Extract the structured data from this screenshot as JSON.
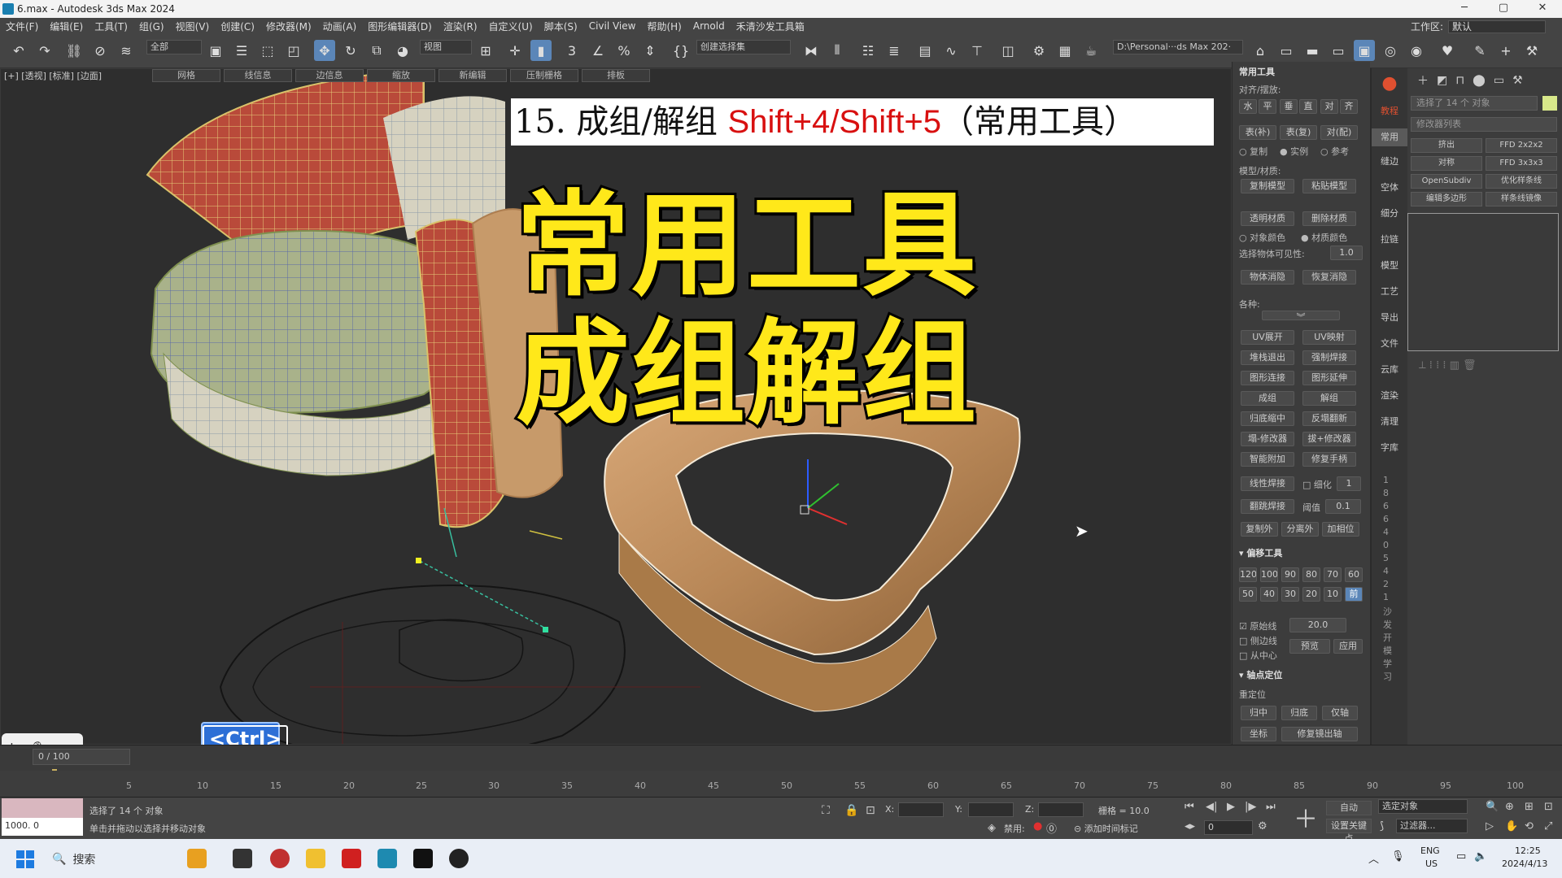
{
  "window": {
    "title": "6.max - Autodesk 3ds Max 2024",
    "min": "─",
    "max": "▢",
    "close": "✕"
  },
  "menu": {
    "items": [
      "文件(F)",
      "编辑(E)",
      "工具(T)",
      "组(G)",
      "视图(V)",
      "创建(C)",
      "修改器(M)",
      "动画(A)",
      "图形编辑器(D)",
      "渲染(R)",
      "自定义(U)",
      "脚本(S)",
      "Civil View",
      "帮助(H)",
      "Arnold",
      "禾清沙发工具箱"
    ],
    "workspace_label": "工作区:",
    "workspace_value": "默认"
  },
  "toolbar": {
    "filter_dropdown": "全部",
    "view_dropdown": "视图",
    "selection_set": "创建选择集",
    "path": "D:\\Personal···ds Max 202·"
  },
  "viewport": {
    "label": "[+] [透视] [标准] [边面]",
    "ribbon": [
      "网格",
      "线信息",
      "边信息",
      "缩放",
      "新编辑",
      "压制栅格",
      "排板"
    ],
    "overlay_number": "15.",
    "overlay_title": "成组/解组",
    "overlay_shortcut": "Shift+4/Shift+5",
    "overlay_suffix": "（常用工具）",
    "big_line1": "常用工具",
    "big_line2": "成组解组",
    "ctrl_badge": "<Ctrl>"
  },
  "tool_panel": {
    "header": "常用工具",
    "align_label": "对齐/摆放:",
    "align_buttons": [
      "水",
      "平",
      "垂",
      "直",
      "对",
      "齐"
    ],
    "table_buttons": [
      "表(补)",
      "表(复)",
      "对(配)"
    ],
    "radio_copy": "复制",
    "radio_instance": "实例",
    "radio_reference": "参考",
    "model_material_label": "模型/材质:",
    "copy_model": "复制模型",
    "paste_model": "粘贴模型",
    "transparent_material": "透明材质",
    "delete_material": "删除材质",
    "object_color": "对象颜色",
    "material_color": "材质颜色",
    "visibility_label": "选择物体可见性:",
    "visibility_value": "1.0",
    "object_hide": "物体消隐",
    "unhide": "恢复消隐",
    "misc_label": "各种:",
    "buttons_grid": [
      [
        "UV展开",
        "UV映射"
      ],
      [
        "堆栈退出",
        "强制焊接"
      ],
      [
        "图形连接",
        "图形延伸"
      ],
      [
        "成组",
        "解组"
      ],
      [
        "归底缩中",
        "反塌翻新"
      ],
      [
        "塌-修改器",
        "拔+修改器"
      ],
      [
        "智能附加",
        "修复手柄"
      ]
    ],
    "line_weld": "线性焊接",
    "refine_label": "细化",
    "refine_value": "1",
    "jump_weld": "翻跳焊接",
    "threshold_label": "阈值",
    "threshold_value": "0.1",
    "copy_out": "复制外",
    "detach_out": "分离外",
    "add_pos": "加相位",
    "offset_header": "偏移工具",
    "offset_row1": [
      "120",
      "100",
      "90",
      "80",
      "70",
      "60"
    ],
    "offset_row2": [
      "50",
      "40",
      "30",
      "20",
      "10",
      "前"
    ],
    "orig_line": "原始线",
    "orig_value": "20.0",
    "side_line": "侧边线",
    "from_center": "从中心",
    "preview": "预览",
    "apply": "应用",
    "pivot_header": "轴点定位",
    "pivot_label": "重定位",
    "pivot_buttons": [
      "归中",
      "归底",
      "仅轴"
    ],
    "coord": "坐标",
    "fix_mirror": "修复镜出轴"
  },
  "side_tabs": [
    "教程",
    "常用",
    "缝边",
    "空体",
    "细分",
    "拉链",
    "模型",
    "工艺",
    "导出",
    "文件",
    "云库",
    "渲染",
    "清理",
    "字库"
  ],
  "vertical_numbers": [
    "1",
    "8",
    "6",
    "6",
    "4",
    "0",
    "5",
    "4",
    "2",
    "1",
    "沙",
    "发",
    "开",
    "模",
    "学",
    "习"
  ],
  "command_panel": {
    "selected_field": "选择了 14 个 对象",
    "modifier_list": "修改器列表",
    "buttons": [
      [
        "挤出",
        "FFD 2x2x2"
      ],
      [
        "对称",
        "FFD 3x3x3"
      ],
      [
        "OpenSubdiv",
        "优化样条线"
      ],
      [
        "编辑多边形",
        "样条线镜像"
      ]
    ]
  },
  "timeline": {
    "frame_field": "0 / 100",
    "ticks": [
      "5",
      "10",
      "15",
      "20",
      "25",
      "30",
      "35",
      "40",
      "45",
      "50",
      "55",
      "60",
      "65",
      "70",
      "75",
      "80",
      "85",
      "90",
      "95",
      "100"
    ]
  },
  "status": {
    "selected": "选择了 14 个 对象",
    "hint": "单击并拖动以选择并移动对象",
    "maxscript_value": "1000. 0",
    "x_label": "X:",
    "y_label": "Y:",
    "z_label": "Z:",
    "grid": "栅格 = 10.0",
    "disable_label": "禁用:",
    "add_time_tag": "添加时间标记",
    "auto": "自动",
    "selected_object": "选定对象",
    "set_key": "设置关键点",
    "filter": "过滤器...",
    "frame_value": "0"
  },
  "taskbar": {
    "search": "搜索",
    "lang_top": "ENG",
    "lang_bottom": "US",
    "time": "12:25",
    "date": "2024/4/13"
  }
}
